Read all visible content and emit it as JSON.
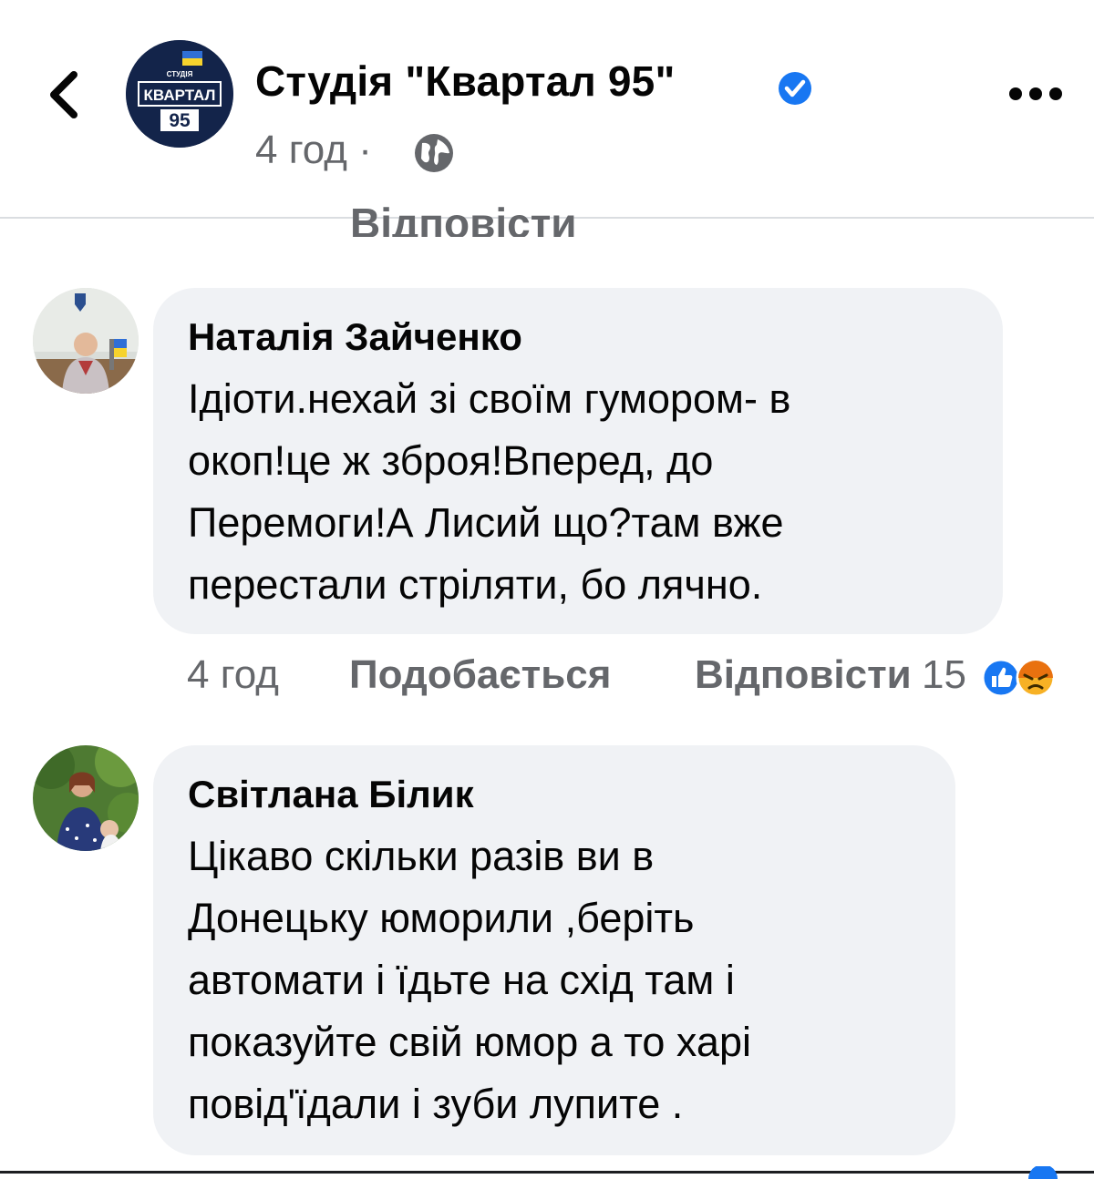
{
  "header": {
    "page_name": "Студія \"Квартал 95\"",
    "post_time": "4 год",
    "separator": "·",
    "logo_top_text": "СТУДІЯ",
    "logo_main_text": "КВАРТАЛ",
    "logo_number": "95",
    "icons": [
      "chevron-left-icon",
      "verified-badge-icon",
      "globe-icon",
      "more-icon"
    ]
  },
  "partial_reply_label": "Відповісти",
  "comments": [
    {
      "author": "Наталія Зайченко",
      "lines": [
        "Ідіоти.нехай зі своїм гумором- в",
        "окоп!це ж зброя!Вперед, до",
        "Перемоги!А Лисий що?там вже",
        "перестали стріляти, бо лячно."
      ],
      "time": "4 год",
      "like_label": "Подобається",
      "reply_label": "Відповісти",
      "reaction_count": "15",
      "reactions": [
        "like",
        "angry"
      ]
    },
    {
      "author": "Світлана Білик",
      "lines": [
        "Цікаво скільки разів ви в",
        "Донецьку юморили  ,беріть",
        "автомати і їдьте на схід там і",
        "показуйте свій юмор  а то харі",
        "повід'їдали і зуби лупите ."
      ]
    }
  ],
  "colors": {
    "bubble": "#f0f2f5",
    "secondary_text": "#65676b",
    "facebook_blue": "#1877f2",
    "angry_orange": "#f7b125"
  }
}
